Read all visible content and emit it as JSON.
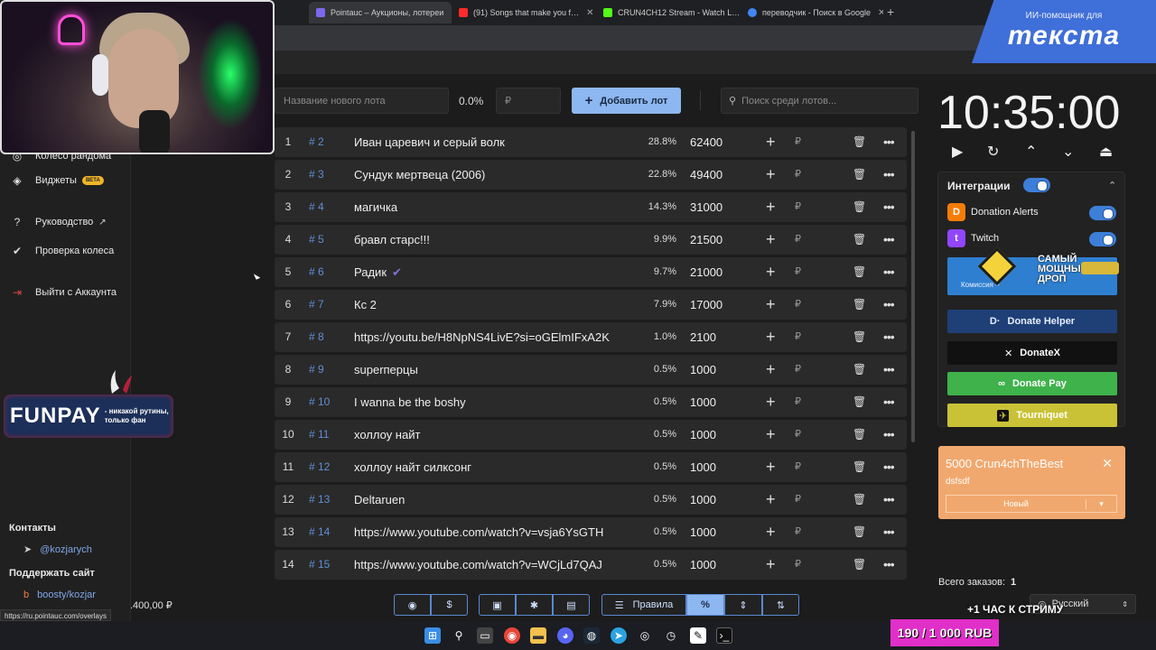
{
  "browser": {
    "tabs": [
      {
        "title": "Pointauc – Аукционы, лотереи",
        "active": true
      },
      {
        "title": "(91) Songs that make you f…",
        "active": false
      },
      {
        "title": "CRUN4CH12 Stream - Watch L…",
        "active": false
      },
      {
        "title": "переводчик - Поиск в Google",
        "active": false
      }
    ],
    "new_tab": "+"
  },
  "overlay": {
    "watermark_small": "ИИ-помощник для",
    "watermark_big": "текста",
    "funpay_logo": "FUNPAY",
    "funpay_tagline_1": "- никакой рутины,",
    "funpay_tagline_2": "только фан",
    "drop_line_1": "САМЫЙ",
    "drop_line_2": "МОЩНЫЙ",
    "drop_line_3": "ДРОП",
    "hour_promo": "+1 ЧАС К СТРИМУ",
    "rub_goal": "190 / 1",
    "rub_goal_rest": "000 RUB"
  },
  "sidebar": {
    "items": [
      {
        "label": "Колесо рандома",
        "icon": "wheel-icon"
      },
      {
        "label": "Виджеты",
        "icon": "layers-icon",
        "badge": "BETA"
      },
      {
        "label": "Руководство",
        "icon": "help-icon",
        "external": true
      },
      {
        "label": "Проверка колеса",
        "icon": "shield-check-icon"
      },
      {
        "label": "Выйти с Аккаунта",
        "icon": "logout-icon"
      }
    ],
    "contacts_header": "Контакты",
    "telegram": "@kozjarych",
    "support_header": "Поддержать сайт",
    "boosty": "boosty/kozjar",
    "balance": ".400,00 ₽",
    "status_url": "https://ru.pointauc.com/overlays"
  },
  "toolbar": {
    "new_lot_placeholder": "Название нового лота",
    "percent": "0.0%",
    "amount_placeholder": "₽",
    "add_button": "Добавить лот",
    "search_placeholder": "Поиск среди лотов..."
  },
  "lots": [
    {
      "n": "1",
      "id": "# 2",
      "name": "Иван царевич и серый волк",
      "pct": "28.8%",
      "amount": "62400"
    },
    {
      "n": "2",
      "id": "# 3",
      "name": "Сундук мертвеца (2006)",
      "pct": "22.8%",
      "amount": "49400"
    },
    {
      "n": "3",
      "id": "# 4",
      "name": "магичка",
      "pct": "14.3%",
      "amount": "31000"
    },
    {
      "n": "4",
      "id": "# 5",
      "name": "бравл старс!!!",
      "pct": "9.9%",
      "amount": "21500"
    },
    {
      "n": "5",
      "id": "# 6",
      "name": "Радик",
      "pct": "9.7%",
      "amount": "21000",
      "verified": true
    },
    {
      "n": "6",
      "id": "# 7",
      "name": "Кс 2",
      "pct": "7.9%",
      "amount": "17000"
    },
    {
      "n": "7",
      "id": "# 8",
      "name": "https://youtu.be/H8NpNS4LivE?si=oGElmIFxA2K",
      "pct": "1.0%",
      "amount": "2100"
    },
    {
      "n": "8",
      "id": "# 9",
      "name": "superперцы",
      "pct": "0.5%",
      "amount": "1000"
    },
    {
      "n": "9",
      "id": "# 10",
      "name": "I wanna be the boshy",
      "pct": "0.5%",
      "amount": "1000"
    },
    {
      "n": "10",
      "id": "# 11",
      "name": "холлоу найт",
      "pct": "0.5%",
      "amount": "1000"
    },
    {
      "n": "11",
      "id": "# 12",
      "name": "холлоу найт силксонг",
      "pct": "0.5%",
      "amount": "1000"
    },
    {
      "n": "12",
      "id": "# 13",
      "name": "Deltaruen",
      "pct": "0.5%",
      "amount": "1000"
    },
    {
      "n": "13",
      "id": "# 14",
      "name": "https://www.youtube.com/watch?v=vsja6YsGTH",
      "pct": "0.5%",
      "amount": "1000"
    },
    {
      "n": "14",
      "id": "# 15",
      "name": "https://www.youtube.com/watch?v=WCjLd7QAJ",
      "pct": "0.5%",
      "amount": "1000"
    }
  ],
  "bottom_toolbar": {
    "rules_label": "Правила",
    "buttons": [
      "github-icon",
      "dollar-icon",
      "save-icon",
      "bug-icon",
      "trash-list-icon",
      "list-icon",
      "percent-icon",
      "compress-icon",
      "sort-icon"
    ]
  },
  "timer": {
    "value": "10:35:00"
  },
  "integrations": {
    "title": "Интеграции",
    "donation_alerts": "Donation Alerts",
    "twitch": "Twitch",
    "promo_commission": "Комиссия –",
    "donate_helper": "Donate Helper",
    "donatex": "DonateX",
    "donate_pay": "Donate Pay",
    "tourniquet": "Tourniquet"
  },
  "alert": {
    "title": "5000 Crun4chTheBest",
    "message": "dsfsdf",
    "status": "Новый"
  },
  "orders": {
    "label": "Всего заказов:",
    "count": "1"
  },
  "language": "Русский",
  "colors": {
    "accent": "#8db7f0",
    "lot_id": "#5f8fd6",
    "alert": "#f1a86e",
    "donate_pay": "#3fb24b",
    "tourniquet": "#c9c236",
    "donatex": "#111111",
    "donate_helper": "#1f3f77"
  }
}
